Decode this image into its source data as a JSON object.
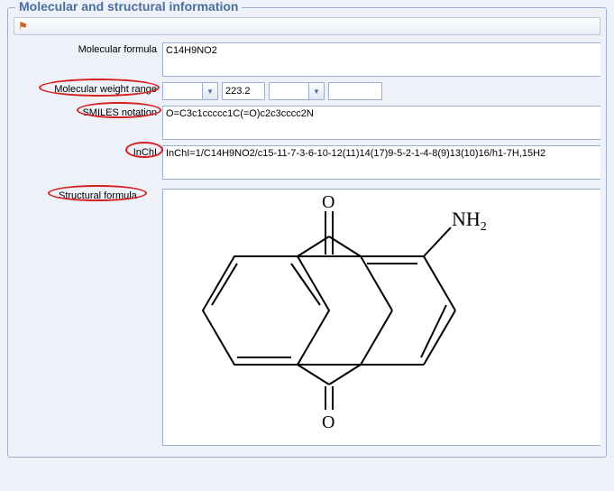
{
  "section": {
    "title": "Molecular and structural information"
  },
  "flag": {
    "icon": "⚑"
  },
  "labels": {
    "molecular_formula": "Molecular formula",
    "molecular_weight_range": "Molecular weight range",
    "smiles_notation": "SMILES notation",
    "inchi": "InChI",
    "structural_formula": "Structural formula"
  },
  "values": {
    "molecular_formula": "C14H9NO2",
    "weight_low": "",
    "weight_value": "223.2",
    "weight_high": "",
    "weight_extra": "",
    "smiles": "O=C3c1ccccc1C(=O)c2c3cccc2N",
    "inchi": "InChI=1/C14H9NO2/c15-11-7-3-6-10-12(11)14(17)9-5-2-1-4-8(9)13(10)16/h1-7H,15H2"
  },
  "annotations": [
    "Molecular weight range",
    "SMILES notation",
    "InChI",
    "Structural formula"
  ],
  "structure": {
    "name": "1-aminoanthraquinone",
    "substituent": "NH2",
    "oxygen": "O"
  }
}
